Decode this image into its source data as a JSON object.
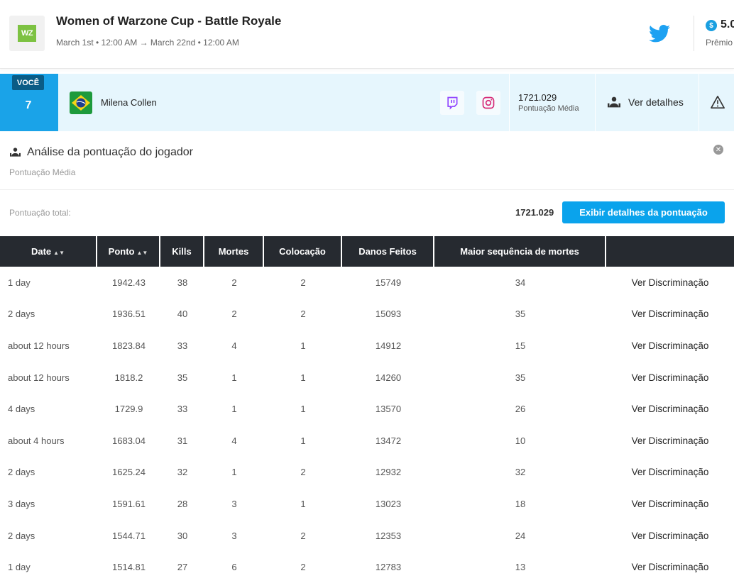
{
  "header": {
    "logo_text": "WZ",
    "title": "Women of Warzone Cup - Battle Royale",
    "dates": "March 1st • 12:00 AM → March 22nd • 12:00 AM",
    "prize_amount": "5.0",
    "prize_label": "Prêmio"
  },
  "player": {
    "you_label": "VOCÊ",
    "rank": "7",
    "name": "Milena Collen",
    "avg_score": "1721.029",
    "avg_label": "Pontuação Média",
    "details_label": "Ver detalhes"
  },
  "analysis": {
    "title": "Análise da pontuação do jogador",
    "subtitle": "Pontuação Média",
    "total_label": "Pontuação total:",
    "total_value": "1721.029",
    "show_button": "Exibir detalhes da pontuação"
  },
  "table": {
    "headers": [
      "Date",
      "Ponto",
      "Kills",
      "Mortes",
      "Colocação",
      "Danos Feitos",
      "Maior sequência de mortes"
    ],
    "link_label": "Ver Discriminação",
    "rows": [
      [
        "1 day",
        "1942.43",
        "38",
        "2",
        "2",
        "15749",
        "34"
      ],
      [
        "2 days",
        "1936.51",
        "40",
        "2",
        "2",
        "15093",
        "35"
      ],
      [
        "about 12 hours",
        "1823.84",
        "33",
        "4",
        "1",
        "14912",
        "15"
      ],
      [
        "about 12 hours",
        "1818.2",
        "35",
        "1",
        "1",
        "14260",
        "35"
      ],
      [
        "4 days",
        "1729.9",
        "33",
        "1",
        "1",
        "13570",
        "26"
      ],
      [
        "about 4 hours",
        "1683.04",
        "31",
        "4",
        "1",
        "13472",
        "10"
      ],
      [
        "2 days",
        "1625.24",
        "32",
        "1",
        "2",
        "12932",
        "32"
      ],
      [
        "3 days",
        "1591.61",
        "28",
        "3",
        "1",
        "13023",
        "18"
      ],
      [
        "2 days",
        "1544.71",
        "30",
        "3",
        "2",
        "12353",
        "24"
      ],
      [
        "1 day",
        "1514.81",
        "27",
        "6",
        "2",
        "12783",
        "13"
      ]
    ]
  }
}
